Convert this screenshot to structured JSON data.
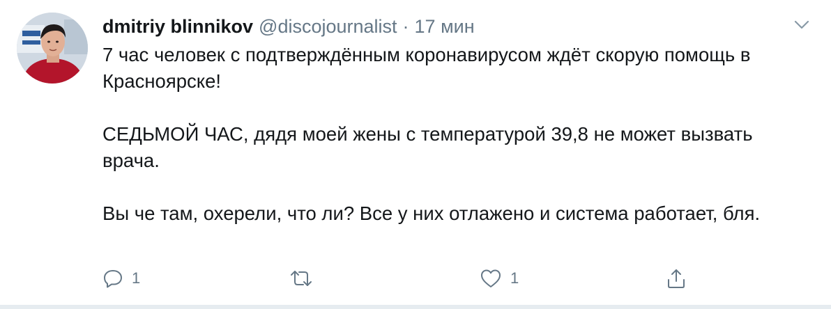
{
  "author": {
    "display_name": "dmitriy blinnikov",
    "handle": "@discojournalist",
    "separator": "·",
    "time": "17 мин"
  },
  "tweet": {
    "paragraphs": [
      "7 час человек с подтверждённым коронавирусом ждёт скорую помощь в Красноярске!",
      "СЕДЬМОЙ ЧАС, дядя моей жены с температурой 39,8 не может вызвать врача.",
      "Вы че там, охерели, что ли? Все у них отлажено и система работает, бля."
    ]
  },
  "actions": {
    "reply_count": "1",
    "retweet_count": "",
    "like_count": "1"
  },
  "icons": {
    "reply": "reply-icon",
    "retweet": "retweet-icon",
    "like": "heart-icon",
    "share": "share-icon",
    "caret": "chevron-down-icon"
  },
  "colors": {
    "text": "#14171a",
    "secondary": "#657786",
    "divider": "#e6ecf0"
  }
}
